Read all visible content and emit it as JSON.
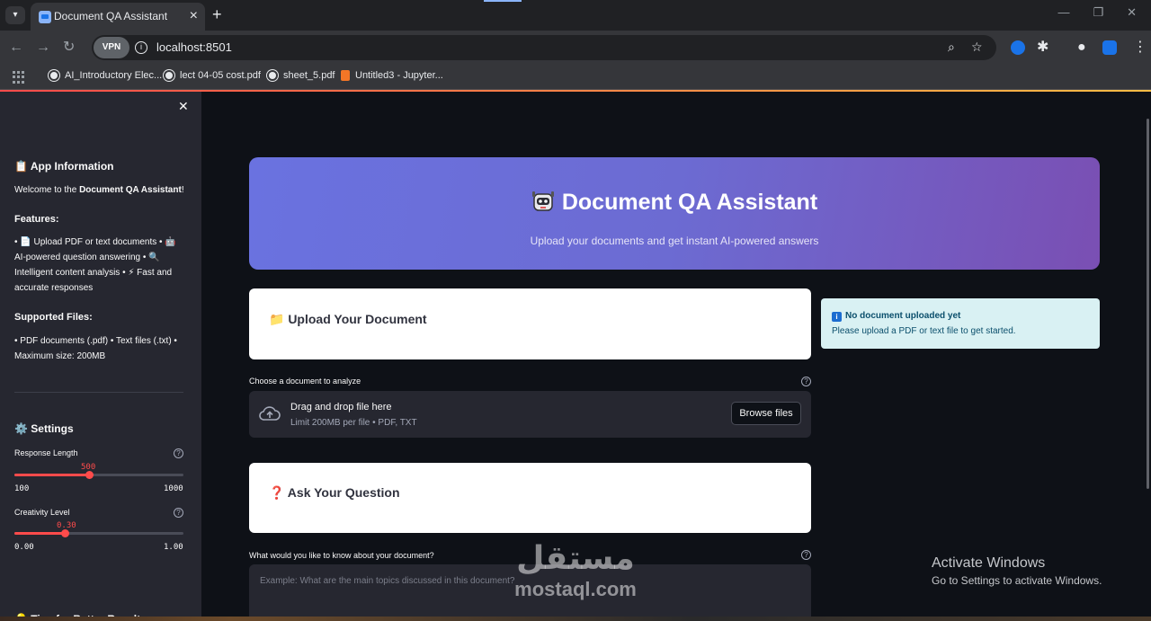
{
  "browser": {
    "tab_title": "Document QA Assistant",
    "url": "localhost:8501",
    "vpn_label": "VPN",
    "bookmarks": [
      {
        "label": "AI_Introductory Elec..."
      },
      {
        "label": "lect 04-05 cost.pdf"
      },
      {
        "label": "sheet_5.pdf"
      },
      {
        "label": "Untitled3 - Jupyter..."
      }
    ]
  },
  "sidebar": {
    "app_info_heading": "📋 App Information",
    "welcome_prefix": "Welcome to the ",
    "welcome_bold": "Document QA Assistant",
    "welcome_suffix": "!",
    "features_heading": "Features:",
    "features_text": "• 📄 Upload PDF or text documents • 🤖 AI-powered question answering • 🔍 Intelligent content analysis • ⚡ Fast and accurate responses",
    "supported_heading": "Supported Files:",
    "supported_text": "• PDF documents (.pdf) • Text files (.txt) • Maximum size: 200MB",
    "settings_heading": "⚙️ Settings",
    "response_length": {
      "label": "Response Length",
      "value": "500",
      "min": "100",
      "max": "1000",
      "fraction": 0.444
    },
    "creativity": {
      "label": "Creativity Level",
      "value": "0.30",
      "min": "0.00",
      "max": "1.00",
      "fraction": 0.3
    },
    "tips_heading": "💡 Tips for Better Results"
  },
  "main": {
    "hero_title": "Document QA Assistant",
    "hero_subtitle": "Upload your documents and get instant AI-powered answers",
    "upload_heading": "📁 Upload Your Document",
    "upload_label": "Choose a document to analyze",
    "drop_title": "Drag and drop file here",
    "drop_sub": "Limit 200MB per file • PDF, TXT",
    "browse_label": "Browse files",
    "info_title": "No document uploaded yet",
    "info_text": "Please upload a PDF or text file to get started.",
    "ask_heading": "❓ Ask Your Question",
    "question_label": "What would you like to know about your document?",
    "question_placeholder": "Example: What are the main topics discussed in this document?"
  },
  "overlay": {
    "watermark_ar": "مستقل",
    "watermark_en": "mostaql.com",
    "activate_title": "Activate Windows",
    "activate_sub": "Go to Settings to activate Windows."
  }
}
